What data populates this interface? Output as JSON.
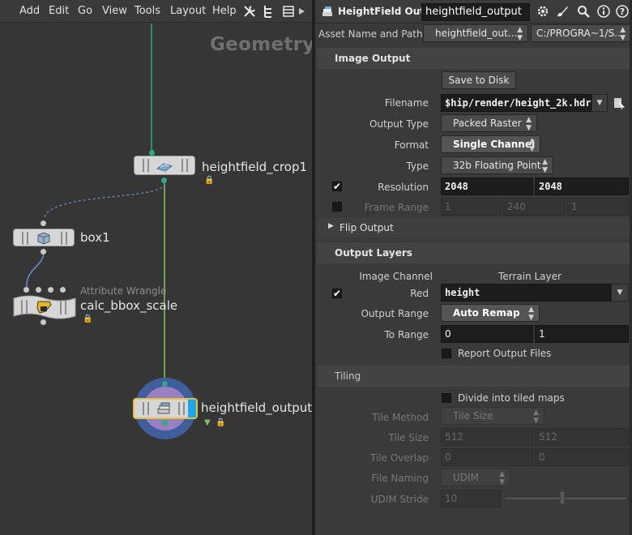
{
  "menubar": {
    "items": [
      "Add",
      "Edit",
      "Go",
      "View",
      "Tools",
      "Layout",
      "Help"
    ],
    "icons": [
      "wrench-icon",
      "tree-icon",
      "list-icon",
      "play-icon"
    ]
  },
  "network": {
    "context_label": "Geometry",
    "nodes": {
      "crop": {
        "name": "heightfield_crop1"
      },
      "box": {
        "name": "box1"
      },
      "wrangle": {
        "type": "Attribute Wrangle",
        "name": "calc_bbox_scale"
      },
      "output": {
        "name": "heightfield_output"
      }
    },
    "colors": {
      "wire_teal": "#2fa88a",
      "wire_green": "#8fbf5a",
      "wire_blue": "#6a8fd0",
      "selected": "#e8c23a",
      "output_halo": "#3f5f9c"
    }
  },
  "parms": {
    "header": {
      "node_type": "HeightField Output",
      "node_name": "heightfield_output",
      "icons": [
        "gear-icon",
        "brush-icon",
        "search-icon",
        "info-icon",
        "help-icon"
      ]
    },
    "asset_row": {
      "label": "Asset Name and Path",
      "asset_name": "heightfield_out...",
      "asset_path": "C:/PROGRA~1/S..."
    },
    "image_output": {
      "title": "Image Output",
      "save_button": "Save to Disk",
      "filename_label": "Filename",
      "filename_value": "$hip/render/height_2k.hdr",
      "output_type_label": "Output Type",
      "output_type_value": "Packed Raster",
      "format_label": "Format",
      "format_value": "Single Channel",
      "type_label": "Type",
      "type_value": "32b Floating Point",
      "resolution_label": "Resolution",
      "resolution_x": "2048",
      "resolution_y": "2048",
      "frame_range_label": "Frame Range",
      "frame_start": "1",
      "frame_end": "240",
      "frame_inc": "1",
      "flip_output_label": "Flip Output"
    },
    "output_layers": {
      "title": "Output Layers",
      "col_image_channel": "Image Channel",
      "col_terrain_layer": "Terrain Layer",
      "red_label": "Red",
      "red_value": "height",
      "output_range_label": "Output Range",
      "output_range_value": "Auto Remap",
      "to_range_label": "To Range",
      "to_range_min": "0",
      "to_range_max": "1",
      "report_label": "Report Output Files"
    },
    "tiling": {
      "title": "Tiling",
      "divide_label": "Divide into tiled maps",
      "tile_method_label": "Tile Method",
      "tile_method_value": "Tile Size",
      "tile_size_label": "Tile Size",
      "tile_size_x": "512",
      "tile_size_y": "512",
      "tile_overlap_label": "Tile Overlap",
      "tile_overlap_x": "0",
      "tile_overlap_y": "0",
      "file_naming_label": "File Naming",
      "file_naming_value": "UDIM",
      "udim_stride_label": "UDIM Stride",
      "udim_stride_value": "10"
    }
  }
}
